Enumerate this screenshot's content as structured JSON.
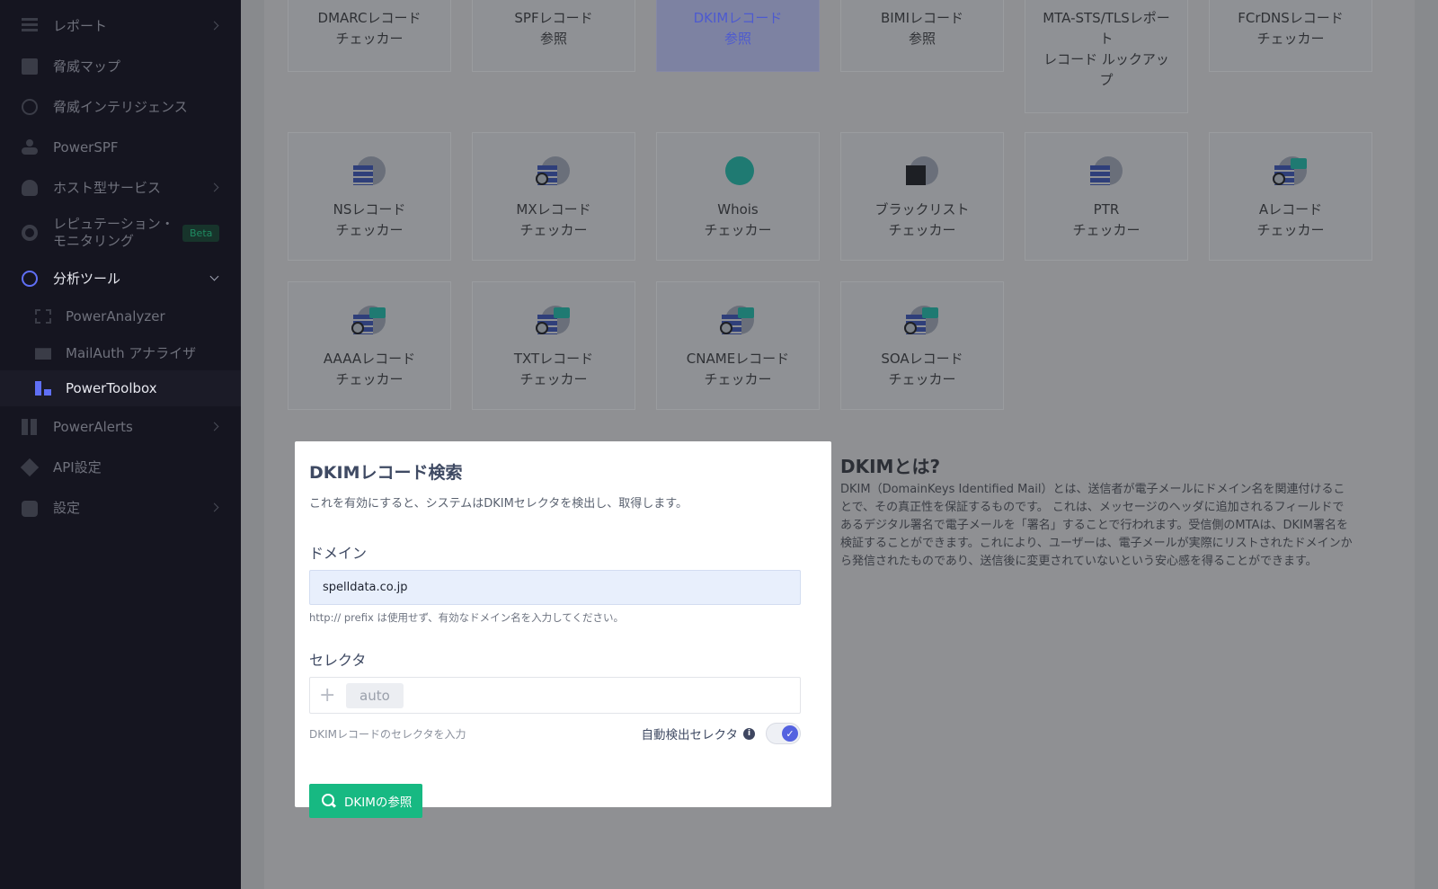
{
  "sidebar": {
    "items": [
      {
        "label": "レポート",
        "icon": "report-icon"
      },
      {
        "label": "脅威マップ",
        "icon": "map-icon"
      },
      {
        "label": "脅威インテリジェンス",
        "icon": "intelligence-icon"
      },
      {
        "label": "PowerSPF",
        "icon": "spf-icon"
      },
      {
        "label": "ホスト型サービス",
        "icon": "host-icon"
      },
      {
        "label": "レピュテーション・モニタリング",
        "icon": "reputation-icon",
        "badge": "Beta"
      },
      {
        "label": "分析ツール",
        "icon": "analysis-icon"
      },
      {
        "label": "PowerAlerts",
        "icon": "alerts-icon"
      },
      {
        "label": "API設定",
        "icon": "api-icon"
      },
      {
        "label": "設定",
        "icon": "settings-icon"
      }
    ],
    "sub_items": [
      {
        "label": "PowerAnalyzer",
        "icon": "analyzer-icon"
      },
      {
        "label": "MailAuth アナライザ",
        "icon": "mail-icon"
      },
      {
        "label": "PowerToolbox",
        "icon": "toolbox-icon"
      }
    ]
  },
  "tools_top": [
    {
      "line1": "DMARCレコード",
      "line2": "チェッカー"
    },
    {
      "line1": "SPFレコード",
      "line2": "参照"
    },
    {
      "line1": "DKIMレコード",
      "line2": "参照"
    },
    {
      "line1": "BIMIレコード",
      "line2": "参照"
    },
    {
      "line1": "MTA-STS/TLSレポート",
      "line2": "レコード ルックアップ"
    },
    {
      "line1": "FCrDNSレコード",
      "line2": "チェッカー"
    }
  ],
  "tools_mid": [
    {
      "line1": "NSレコード",
      "line2": "チェッカー",
      "icon": "ns-icon"
    },
    {
      "line1": "MXレコード",
      "line2": "チェッカー",
      "icon": "mx-icon"
    },
    {
      "line1": "Whois",
      "line2": "チェッカー",
      "icon": "whois-icon"
    },
    {
      "line1": "ブラックリスト",
      "line2": "チェッカー",
      "icon": "blacklist-icon"
    },
    {
      "line1": "PTR",
      "line2": "チェッカー",
      "icon": "ptr-icon"
    },
    {
      "line1": "Aレコード",
      "line2": "チェッカー",
      "icon": "a-record-icon"
    }
  ],
  "tools_bottom": [
    {
      "line1": "AAAAレコード",
      "line2": "チェッカー",
      "icon": "aaaa-icon"
    },
    {
      "line1": "TXTレコード",
      "line2": "チェッカー",
      "icon": "txt-icon"
    },
    {
      "line1": "CNAMEレコード",
      "line2": "チェッカー",
      "icon": "cname-icon"
    },
    {
      "line1": "SOAレコード",
      "line2": "チェッカー",
      "icon": "soa-icon"
    }
  ],
  "form": {
    "title": "DKIMレコード検索",
    "description": "これを有効にすると、システムはDKIMセレクタを検出し、取得します。",
    "domain_label": "ドメイン",
    "domain_value": "spelldata.co.jp",
    "domain_hint": "http:// prefix は使用せず、有効なドメイン名を入力してください。",
    "selector_label": "セレクタ",
    "selector_chip": "auto",
    "selector_hint": "DKIMレコードのセレクタを入力",
    "auto_detect_label": "自動検出セレクタ",
    "auto_detect_on": true,
    "submit_label": "DKIMの参照"
  },
  "info": {
    "title": "DKIMとは?",
    "text": "DKIM（DomainKeys Identified Mail）とは、送信者が電子メールにドメイン名を関連付けることで、その真正性を保証するものです。 これは、メッセージのヘッダに追加されるフィールドであるデジタル署名で電子メールを「署名」することで行われます。受信側のMTAは、DKIM署名を検証することができます。これにより、ユーザーは、電子メールが実際にリストされたドメインから発信されたものであり、送信後に変更されていないという安心感を得ることができます。"
  },
  "colors": {
    "sidebar_bg": "#151520",
    "accent": "#5462e0",
    "button_green": "#17b982"
  }
}
